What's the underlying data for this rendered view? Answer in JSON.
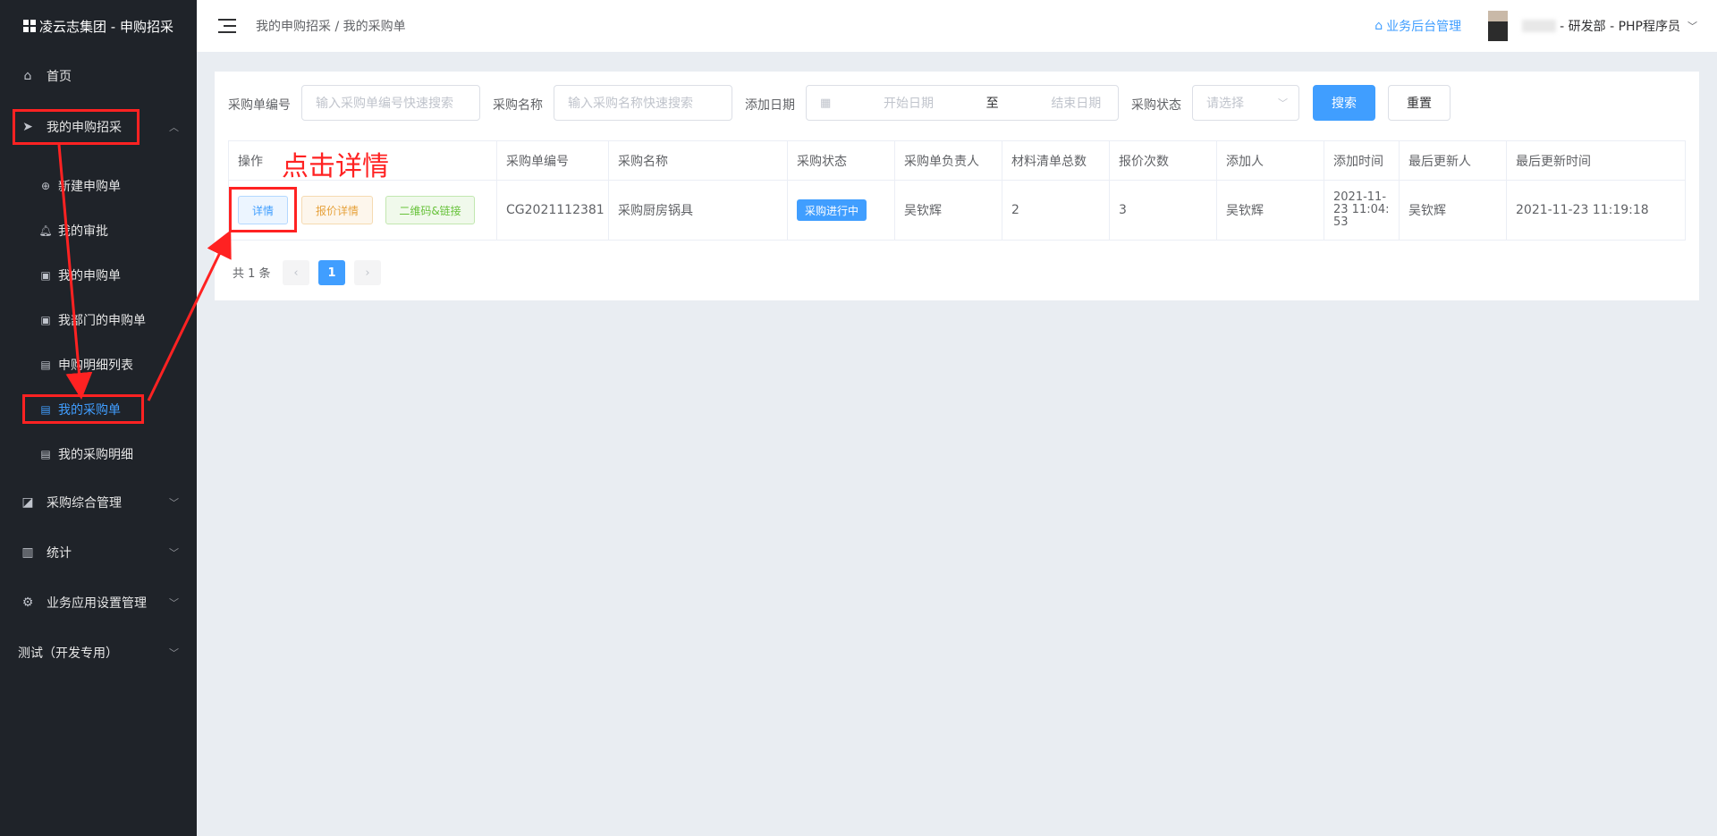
{
  "app": {
    "title": "凌云志集团 - 申购招采"
  },
  "sidebar": {
    "home": "首页",
    "my_procurement": "我的申购招采",
    "sub_items": [
      {
        "label": "新建申购单",
        "icon": "plus-circle-icon"
      },
      {
        "label": "我的审批",
        "icon": "bell-icon"
      },
      {
        "label": "我的申购单",
        "icon": "bag-icon"
      },
      {
        "label": "我部门的申购单",
        "icon": "bag-icon"
      },
      {
        "label": "申购明细列表",
        "icon": "clipboard-icon"
      },
      {
        "label": "我的采购单",
        "icon": "clipboard-check-icon",
        "active": true
      },
      {
        "label": "我的采购明细",
        "icon": "clipboard-icon"
      }
    ],
    "purchase_mgmt": "采购综合管理",
    "stats": "统计",
    "app_settings": "业务应用设置管理",
    "test": "测试（开发专用）"
  },
  "header": {
    "breadcrumb": "我的申购招采 / 我的采购单",
    "biz_admin": "业务后台管理",
    "user": "- 研发部 - PHP程序员"
  },
  "filters": {
    "order_no_label": "采购单编号",
    "order_no_placeholder": "输入采购单编号快速搜索",
    "name_label": "采购名称",
    "name_placeholder": "输入采购名称快速搜索",
    "date_label": "添加日期",
    "start_placeholder": "开始日期",
    "range_sep": "至",
    "end_placeholder": "结束日期",
    "status_label": "采购状态",
    "status_placeholder": "请选择",
    "search_button": "搜索",
    "reset_button": "重置"
  },
  "table": {
    "columns": [
      "操作",
      "采购单编号",
      "采购名称",
      "采购状态",
      "采购单负责人",
      "材料清单总数",
      "报价次数",
      "添加人",
      "添加时间",
      "最后更新人",
      "最后更新时间"
    ],
    "row": {
      "actions": {
        "detail": "详情",
        "quote_detail": "报价详情",
        "qr_link": "二维码&链接"
      },
      "order_no": "CG2021112381",
      "name": "采购厨房锅具",
      "status": "采购进行中",
      "owner": "吴钦辉",
      "material_count": "2",
      "quote_count": "3",
      "creator": "吴钦辉",
      "created_at": "2021-11-23 11:04:53",
      "updater": "吴钦辉",
      "updated_at": "2021-11-23 11:19:18"
    }
  },
  "pagination": {
    "total": "共 1 条",
    "current": "1",
    "prev": "‹",
    "next": "›"
  },
  "annotation": {
    "text": "点击详情"
  },
  "colors": {
    "sidebar_bg": "#1f2329",
    "primary": "#409eff",
    "annotation": "#ff2222"
  }
}
